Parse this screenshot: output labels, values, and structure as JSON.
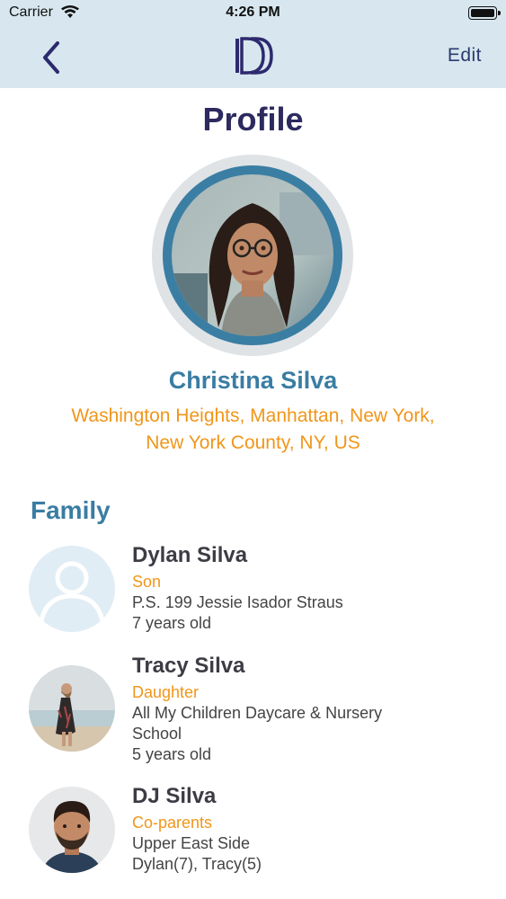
{
  "status_bar": {
    "carrier": "Carrier",
    "time": "4:26 PM",
    "battery_level": 1.0
  },
  "nav": {
    "back_icon": "chevron-left-icon",
    "logo_icon": "dd-logo-icon",
    "edit_label": "Edit"
  },
  "page": {
    "title": "Profile"
  },
  "profile": {
    "name": "Christina Silva",
    "address_line1": "Washington Heights, Manhattan, New York,",
    "address_line2": "New York County, NY, US"
  },
  "family": {
    "title": "Family",
    "members": [
      {
        "name": "Dylan Silva",
        "role": "Son",
        "line1": "P.S. 199 Jessie Isador Straus",
        "line2": "",
        "line3": "7 years old"
      },
      {
        "name": "Tracy Silva",
        "role": "Daughter",
        "line1": "All My Children Daycare & Nursery",
        "line2": "School",
        "line3": "5 years old"
      },
      {
        "name": "DJ Silva",
        "role": "Co-parents",
        "line1": "Upper East Side",
        "line2": "",
        "line3": "Dylan(7), Tracy(5)"
      }
    ]
  },
  "colors": {
    "topbar": "#d8e7ef",
    "title": "#2c2a5e",
    "accent_blue": "#3a7da3",
    "accent_orange": "#f0961a"
  }
}
